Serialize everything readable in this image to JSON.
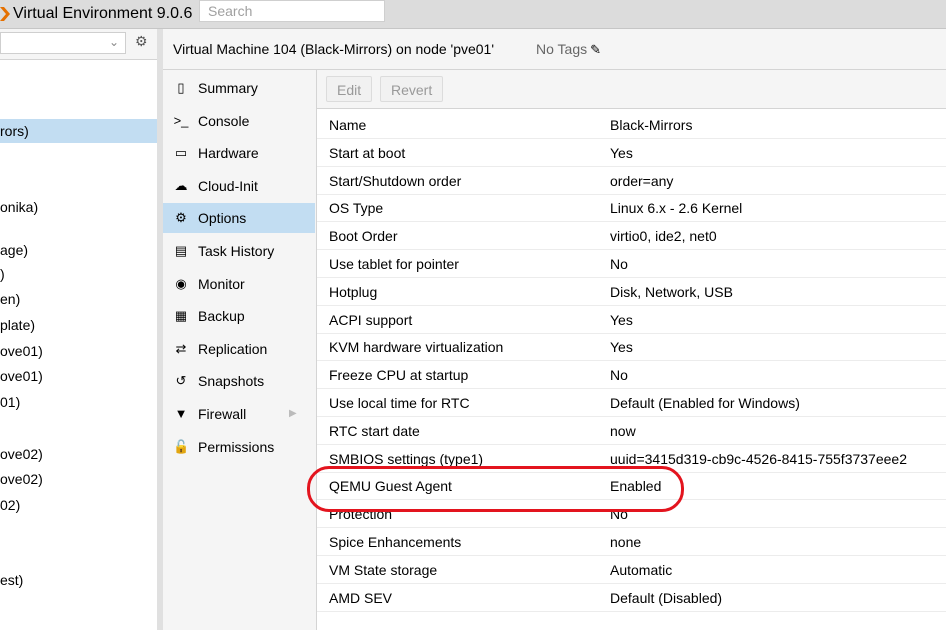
{
  "topbar": {
    "title": "Virtual Environment 9.0.6",
    "search_placeholder": "Search"
  },
  "tree": {
    "items": [
      {
        "label": "rors)",
        "selected": true
      },
      {
        "label": "onika)",
        "selected": false
      },
      {
        "label": "age)",
        "selected": false
      },
      {
        "label": ")",
        "selected": false
      },
      {
        "label": "en)",
        "selected": false
      },
      {
        "label": "plate)",
        "selected": false
      },
      {
        "label": "ove01)",
        "selected": false
      },
      {
        "label": "ove01)",
        "selected": false
      },
      {
        "label": "01)",
        "selected": false
      },
      {
        "label": "ove02)",
        "selected": false
      },
      {
        "label": "ove02)",
        "selected": false
      },
      {
        "label": "02)",
        "selected": false
      },
      {
        "label": "est)",
        "selected": false
      }
    ]
  },
  "header": {
    "vm_title": "Virtual Machine 104 (Black-Mirrors) on node 'pve01'",
    "tags": "No Tags"
  },
  "nav": {
    "items": [
      {
        "label": "Summary",
        "icon": "book-icon"
      },
      {
        "label": "Console",
        "icon": "terminal-icon"
      },
      {
        "label": "Hardware",
        "icon": "monitor-icon"
      },
      {
        "label": "Cloud-Init",
        "icon": "cloud-icon"
      },
      {
        "label": "Options",
        "icon": "gear-icon"
      },
      {
        "label": "Task History",
        "icon": "list-icon"
      },
      {
        "label": "Monitor",
        "icon": "eye-icon"
      },
      {
        "label": "Backup",
        "icon": "floppy-icon"
      },
      {
        "label": "Replication",
        "icon": "retweet-icon"
      },
      {
        "label": "Snapshots",
        "icon": "history-icon"
      },
      {
        "label": "Firewall",
        "icon": "shield-icon"
      },
      {
        "label": "Permissions",
        "icon": "unlock-icon"
      }
    ],
    "selected": "Options"
  },
  "toolbar": {
    "edit_label": "Edit",
    "revert_label": "Revert"
  },
  "options": [
    {
      "key": "Name",
      "value": "Black-Mirrors"
    },
    {
      "key": "Start at boot",
      "value": "Yes"
    },
    {
      "key": "Start/Shutdown order",
      "value": "order=any"
    },
    {
      "key": "OS Type",
      "value": "Linux 6.x - 2.6 Kernel"
    },
    {
      "key": "Boot Order",
      "value": "virtio0, ide2, net0"
    },
    {
      "key": "Use tablet for pointer",
      "value": "No"
    },
    {
      "key": "Hotplug",
      "value": "Disk, Network, USB"
    },
    {
      "key": "ACPI support",
      "value": "Yes"
    },
    {
      "key": "KVM hardware virtualization",
      "value": "Yes"
    },
    {
      "key": "Freeze CPU at startup",
      "value": "No"
    },
    {
      "key": "Use local time for RTC",
      "value": "Default (Enabled for Windows)"
    },
    {
      "key": "RTC start date",
      "value": "now"
    },
    {
      "key": "SMBIOS settings (type1)",
      "value": "uuid=3415d319-cb9c-4526-8415-755f3737eee2"
    },
    {
      "key": "QEMU Guest Agent",
      "value": "Enabled"
    },
    {
      "key": "Protection",
      "value": "No"
    },
    {
      "key": "Spice Enhancements",
      "value": "none"
    },
    {
      "key": "VM State storage",
      "value": "Automatic"
    },
    {
      "key": "AMD SEV",
      "value": "Default (Disabled)"
    }
  ],
  "colors": {
    "selection": "#c2ddf2",
    "highlight_ring": "#e3141e",
    "brand_orange": "#e57000"
  }
}
